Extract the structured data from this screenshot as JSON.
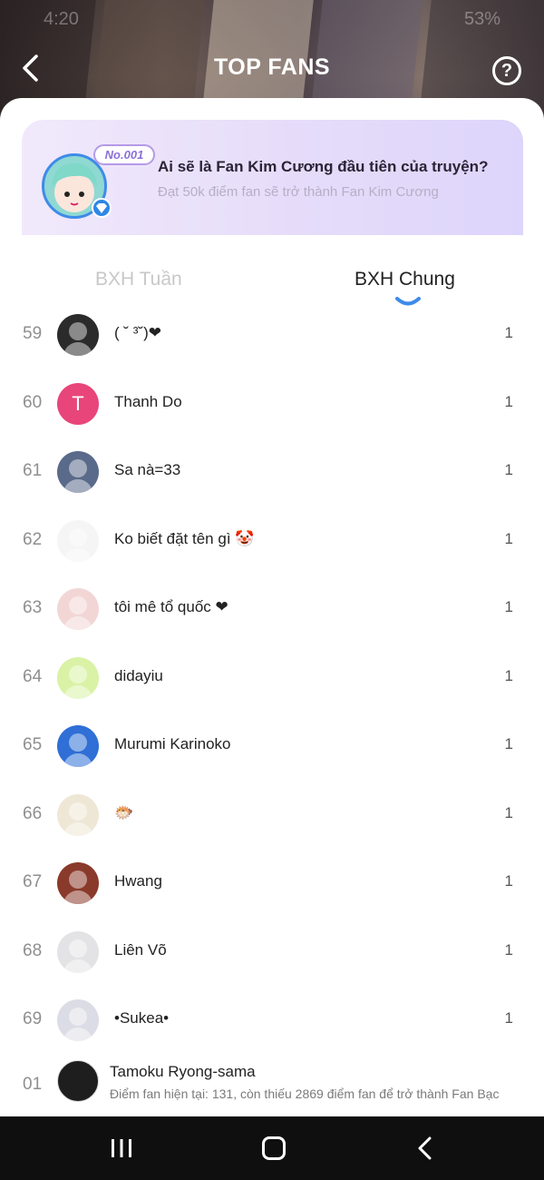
{
  "status_bar": {
    "time": "4:20",
    "battery": "53%"
  },
  "header": {
    "title": "TOP FANS",
    "help_symbol": "?"
  },
  "promo": {
    "badge": "No.001",
    "headline": "Ai sẽ là Fan Kim Cương đầu tiên của truyện?",
    "subtext": "Đạt 50k điểm fan sẽ trở thành Fan Kim Cương"
  },
  "tabs": {
    "weekly": "BXH Tuần",
    "overall": "BXH Chung",
    "active": "overall"
  },
  "fans": [
    {
      "rank": "59",
      "name": "( ˘ ³˘)❤",
      "score": "1",
      "avatar_color": "#2b2b2b"
    },
    {
      "rank": "60",
      "name": "Thanh Do",
      "score": "1",
      "avatar_color": "#e8457b",
      "initial": "T"
    },
    {
      "rank": "61",
      "name": "Sa nà=33",
      "score": "1",
      "avatar_color": "#5a6a8a"
    },
    {
      "rank": "62",
      "name": "Ko biết đặt tên gì 🤡",
      "score": "1",
      "avatar_color": "#f5f5f5"
    },
    {
      "rank": "63",
      "name": "tôi mê tổ quốc ❤",
      "score": "1",
      "avatar_color": "#f2d6d6"
    },
    {
      "rank": "64",
      "name": "didayiu",
      "score": "1",
      "avatar_color": "#d9f2a6"
    },
    {
      "rank": "65",
      "name": "Murumi Karinoko",
      "score": "1",
      "avatar_color": "#2f6fd6"
    },
    {
      "rank": "66",
      "name": "🐡",
      "score": "1",
      "avatar_color": "#efe7d6"
    },
    {
      "rank": "67",
      "name": "Hwang",
      "score": "1",
      "avatar_color": "#8a3a2a"
    },
    {
      "rank": "68",
      "name": "Liên Võ",
      "score": "1",
      "avatar_color": "#e3e3e6"
    },
    {
      "rank": "69",
      "name": "•Sukea•",
      "score": "1",
      "avatar_color": "#dcdce6"
    }
  ],
  "me": {
    "rank": "01",
    "name": "Tamoku Ryong-sama",
    "desc": "Điểm fan hiện tại: 131, còn thiếu 2869 điểm fan để trở thành Fan Bạc",
    "avatar_color": "#1e1e1e"
  },
  "colors": {
    "accent": "#3f8be8",
    "promo_bg": "#e6dcfa",
    "nav_bg": "#0f0f0f"
  }
}
